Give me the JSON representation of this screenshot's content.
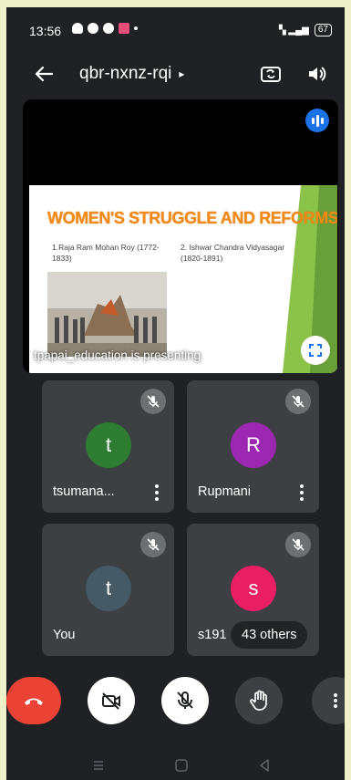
{
  "status_bar": {
    "time": "13:56",
    "network": "VoLTE 4G",
    "battery": "67"
  },
  "header": {
    "meeting_code": "qbr-nxnz-rqi",
    "caret": "▸"
  },
  "presentation": {
    "slide": {
      "title": "WOMEN'S STRUGGLE AND REFORMS",
      "item1": "1.Raja Ram Mohan Roy (1772-1833)",
      "item2": "2. Ishwar Chandra Vidyasagar (1820-1891)"
    },
    "presenter_label": "tpapai_education is presenting"
  },
  "participants": [
    {
      "initial": "t",
      "name": "tsumana...",
      "avatar_color": "#2e7d32"
    },
    {
      "initial": "R",
      "name": "Rupmani",
      "avatar_color": "#9c27b0"
    },
    {
      "initial": "t",
      "name": "You",
      "avatar_color": "#455a64"
    },
    {
      "initial": "s",
      "name": "s191",
      "avatar_color": "#e91e63",
      "others": "43 others"
    }
  ],
  "colors": {
    "end_call": "#ea4335",
    "accent": "#1a73e8",
    "slide_title": "#f28a17"
  }
}
